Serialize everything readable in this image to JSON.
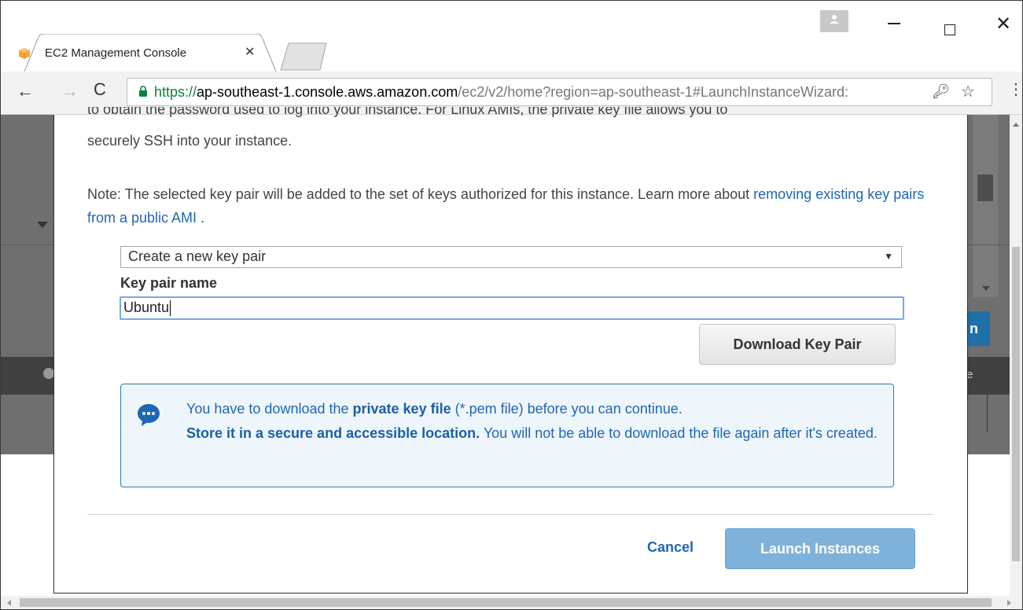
{
  "browser": {
    "tab_title": "EC2 Management Console",
    "tab_close": "✕",
    "url_scheme": "https://",
    "url_host": "ap-southeast-1.console.aws.amazon.com",
    "url_path": "/ec2/v2/home?region=ap-southeast-1#LaunchInstanceWizard:"
  },
  "background": {
    "partial_button": "n",
    "partial_text": "e"
  },
  "modal": {
    "cut_text": "to obtain the password used to log into your instance. For Linux AMIs, the private key file allows you to",
    "intro_text": "securely SSH into your instance.",
    "note_text": "Note: The selected key pair will be added to the set of keys authorized for this instance. Learn more about ",
    "note_link": "removing existing key pairs from a public AMI",
    "note_end": " .",
    "key_pair_select": {
      "selected": "Create a new key pair",
      "arrow": "▼"
    },
    "key_pair_name_label": "Key pair name",
    "key_pair_name_value": "Ubuntu",
    "download_button": "Download Key Pair",
    "info": {
      "pre": "You have to download the ",
      "bold1": "private key file",
      "mid": " (*.pem file) before you can continue.",
      "bold2": "Store it in a secure and accessible location.",
      "post": " You will not be able to download the file again after it's created."
    },
    "cancel_button": "Cancel",
    "launch_button": "Launch Instances"
  },
  "colors": {
    "link": "#1f66b5",
    "info_border": "#2f78b9",
    "info_background": "#eef6fc",
    "launch_disabled": "#7fb2da",
    "dim_overlay": "#6f6f6f"
  },
  "icons": {
    "favicon": "aws-box-icon",
    "lock": "lock-icon",
    "key": "key-icon",
    "star": "bookmark-star-icon",
    "menu": "more-vert-icon",
    "info": "chat-bubble-icon"
  }
}
